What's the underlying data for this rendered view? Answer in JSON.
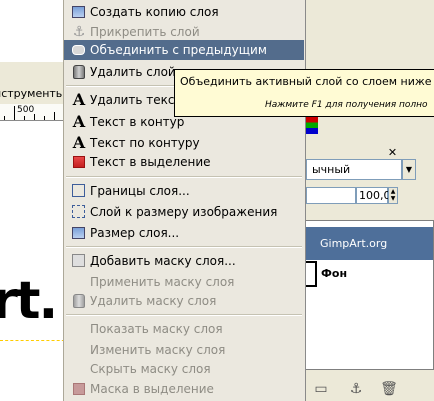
{
  "background": {
    "toolbar_label": "нструменть",
    "ruler_label": "500",
    "canvas_text": "rt."
  },
  "menu": {
    "items": [
      {
        "label": "Создать копию слоя",
        "icon": "duplicate-layer-icon",
        "disabled": false,
        "highlighted": false
      },
      {
        "label": "Прикрепить слой",
        "icon": "anchor-icon",
        "disabled": true,
        "highlighted": false
      },
      {
        "label": "Объединить с предыдущим",
        "icon": "merge-down-icon",
        "disabled": false,
        "highlighted": true
      },
      {
        "label": "Удалить слой",
        "icon": "trash-can-icon",
        "disabled": false,
        "highlighted": false
      },
      {
        "label": "Удалить текстовую информацию",
        "icon": "text-tool-icon",
        "disabled": false,
        "highlighted": false
      },
      {
        "label": "Текст в контур",
        "icon": "text-tool-icon",
        "disabled": false,
        "highlighted": false
      },
      {
        "label": "Текст по контуру",
        "icon": "text-tool-icon",
        "disabled": false,
        "highlighted": false
      },
      {
        "label": "Текст в выделение",
        "icon": "selection-red-icon",
        "disabled": false,
        "highlighted": false
      },
      {
        "label": "Границы слоя...",
        "icon": "layer-boundary-icon",
        "disabled": false,
        "highlighted": false
      },
      {
        "label": "Слой к размеру изображения",
        "icon": "layer-to-image-size-icon",
        "disabled": false,
        "highlighted": false
      },
      {
        "label": "Размер слоя...",
        "icon": "scale-layer-icon",
        "disabled": false,
        "highlighted": false
      },
      {
        "label": "Добавить маску слоя...",
        "icon": "add-mask-icon",
        "disabled": false,
        "highlighted": false
      },
      {
        "label": "Применить маску слоя",
        "icon": "",
        "disabled": true,
        "highlighted": false
      },
      {
        "label": "Удалить маску слоя",
        "icon": "trash-can-icon",
        "disabled": true,
        "highlighted": false
      },
      {
        "label": "Показать маску слоя",
        "icon": "",
        "disabled": true,
        "highlighted": false
      },
      {
        "label": "Изменить маску слоя",
        "icon": "",
        "disabled": true,
        "highlighted": false
      },
      {
        "label": "Скрыть маску слоя",
        "icon": "",
        "disabled": true,
        "highlighted": false
      },
      {
        "label": "Маска в выделение",
        "icon": "selection-red-icon",
        "disabled": true,
        "highlighted": false
      }
    ]
  },
  "tooltip": {
    "text": "Объединить активный слой со слоем ниже в",
    "hint": "Нажмите F1 для получения полно"
  },
  "layers_panel": {
    "mode_value": "ычный",
    "opacity_value": "100,0",
    "layers": [
      {
        "name": "GimpArt.org",
        "selected": true
      },
      {
        "name": "Фон",
        "selected": false
      }
    ],
    "colors": {
      "selected_row": "#4e6f9a",
      "menu_highlight": "#536c8c",
      "tooltip_bg": "#fffbd4"
    }
  }
}
